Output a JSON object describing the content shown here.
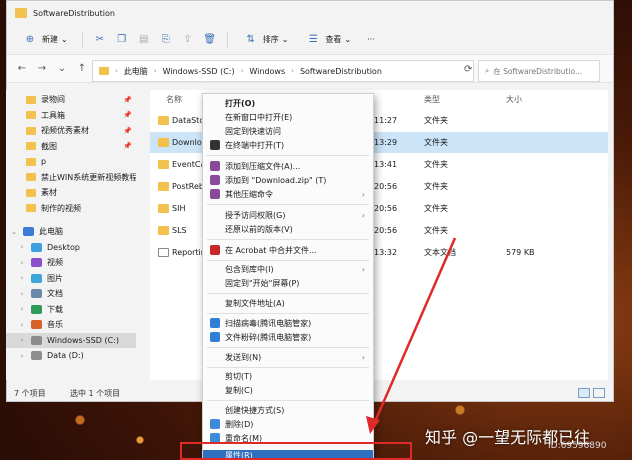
{
  "window": {
    "title": "SoftwareDistribution"
  },
  "toolbar": {
    "new_label": "新建",
    "sort_label": "排序",
    "view_label": "查看",
    "more_label": "···"
  },
  "address": {
    "crumbs": [
      "此电脑",
      "Windows-SSD (C:)",
      "Windows",
      "SoftwareDistribution"
    ],
    "search_placeholder": "在 SoftwareDistributio..."
  },
  "sidebar": {
    "quick": [
      "录物间",
      "工具箱",
      "视频优秀素材",
      "截图",
      "p",
      "禁止WIN系统更新视频教程",
      "素材",
      "制作的视频"
    ],
    "this_pc": "此电脑",
    "drives": [
      "Desktop",
      "视频",
      "图片",
      "文档",
      "下载",
      "音乐",
      "Windows-SSD (C:)",
      "Data (D:)"
    ]
  },
  "columns": {
    "name": "名称",
    "type": "类型",
    "size": "大小"
  },
  "files": [
    {
      "name": "DataStore",
      "date": "11:27",
      "type": "文件夹",
      "size": ""
    },
    {
      "name": "Download",
      "date": "13:29",
      "type": "文件夹",
      "size": ""
    },
    {
      "name": "EventCache",
      "date": "13:41",
      "type": "文件夹",
      "size": ""
    },
    {
      "name": "PostRebootEventCache",
      "date": "20:56",
      "type": "文件夹",
      "size": ""
    },
    {
      "name": "SIH",
      "date": "20:56",
      "type": "文件夹",
      "size": ""
    },
    {
      "name": "SLS",
      "date": "20:56",
      "type": "文件夹",
      "size": ""
    },
    {
      "name": "ReportingEvents",
      "date": "13:32",
      "type": "文本文档",
      "size": "579 KB"
    }
  ],
  "status": {
    "count": "7 个项目",
    "selected": "选中 1 个项目"
  },
  "context_menu": {
    "open": "打开(O)",
    "open_new_window": "在新窗口中打开(E)",
    "pin_quick": "固定到快速访问",
    "open_terminal": "在终端中打开(T)",
    "add_archive": "添加到压缩文件(A)...",
    "add_zip": "添加到 \"Download.zip\" (T)",
    "other_compress": "其他压缩命令",
    "grant_access": "授予访问权限(G)",
    "restore_versions": "还原以前的版本(V)",
    "acrobat": "在 Acrobat 中合并文件...",
    "include_library": "包含到库中(I)",
    "pin_start": "固定到\"开始\"屏幕(P)",
    "copy_path": "复制文件地址(A)",
    "scan_virus": "扫描病毒(腾讯电脑管家)",
    "file_shred": "文件粉碎(腾讯电脑管家)",
    "send_to": "发送到(N)",
    "cut": "剪切(T)",
    "copy": "复制(C)",
    "create_shortcut": "创建快捷方式(S)",
    "delete": "删除(D)",
    "rename": "重命名(M)",
    "properties": "属性(R)"
  },
  "watermark": {
    "text": "知乎 @一望无际都已往",
    "id": "ID:69596890"
  },
  "colors": {
    "selection": "#cce4f7",
    "menu_highlight": "#2e6fbf",
    "annotation": "#e02a2a",
    "folder": "#f2c14e"
  }
}
